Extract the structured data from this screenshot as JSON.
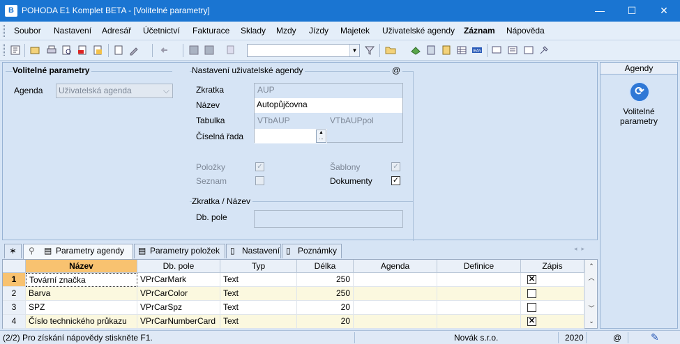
{
  "window": {
    "title": "POHODA E1 Komplet BETA - [Volitelné parametry]",
    "app_icon_text": "B"
  },
  "menu": [
    "Soubor",
    "Nastavení",
    "Adresář",
    "Účetnictví",
    "Fakturace",
    "Sklady",
    "Mzdy",
    "Jízdy",
    "Majetek",
    "Uživatelské agendy",
    "Záznam",
    "Nápověda"
  ],
  "left_group": {
    "title": "Volitelné parametry",
    "agenda_label": "Agenda",
    "agenda_value": "Uživatelská agenda"
  },
  "user_agenda": {
    "title": "Nastavení uživatelské agendy",
    "at_sign": "@",
    "zkratka_label": "Zkratka",
    "zkratka_value": "AUP",
    "nazev_label": "Název",
    "nazev_value": "Autopůjčovna",
    "tabulka_label": "Tabulka",
    "tabulka_value1": "VTbAUP",
    "tabulka_value2": "VTbAUPpol",
    "ciselna_label": "Číselná řada",
    "polozky_label": "Položky",
    "seznam_label": "Seznam",
    "sablony_label": "Šablony",
    "dokumenty_label": "Dokumenty"
  },
  "zkratka_nazev": {
    "title": "Zkratka / Název",
    "dbpole_label": "Db. pole"
  },
  "tabs": [
    "Parametry agendy",
    "Parametry položek",
    "Nastavení",
    "Poznámky"
  ],
  "grid": {
    "columns": [
      "Název",
      "Db. pole",
      "Typ",
      "Délka",
      "Agenda",
      "Definice",
      "Zápis"
    ],
    "rows": [
      {
        "num": "1",
        "nazev": "Tovární značka",
        "dbpole": "VPrCarMark",
        "typ": "Text",
        "delka": "250",
        "zapis": "✕"
      },
      {
        "num": "2",
        "nazev": "Barva",
        "dbpole": "VPrCarColor",
        "typ": "Text",
        "delka": "250",
        "zapis": ""
      },
      {
        "num": "3",
        "nazev": "SPZ",
        "dbpole": "VPrCarSpz",
        "typ": "Text",
        "delka": "20",
        "zapis": ""
      },
      {
        "num": "4",
        "nazev": "Číslo technického průkazu",
        "dbpole": "VPrCarNumberCard",
        "typ": "Text",
        "delka": "20",
        "zapis": "✕"
      }
    ]
  },
  "right_panel": {
    "header": "Agendy",
    "item_label": "Volitelné parametry"
  },
  "status": {
    "help": "(2/2) Pro získání nápovědy stiskněte F1.",
    "company": "Novák s.r.o.",
    "year": "2020",
    "at": "@"
  }
}
